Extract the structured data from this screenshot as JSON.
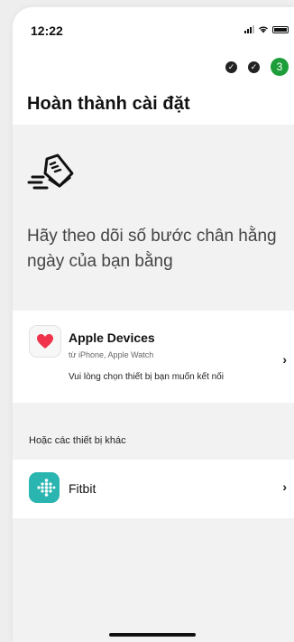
{
  "status_bar": {
    "time": "12:22"
  },
  "progress": {
    "done_steps": [
      "✓",
      "✓"
    ],
    "current_step": "3",
    "accent_color": "#1e9e3a"
  },
  "header": {
    "title": "Hoàn thành cài đặt"
  },
  "intro": {
    "icon": "shoe-speed-icon",
    "text": "Hãy theo dõi số bước chân hằng ngày của bạn bằng"
  },
  "apple_devices": {
    "icon": "heart-icon",
    "title": "Apple Devices",
    "subtitle": "từ iPhone, Apple Watch",
    "hint": "Vui lòng chọn thiết bị bạn muốn kết nối",
    "chevron": "›"
  },
  "other_devices": {
    "section_label": "Hoặc các thiết bị khác",
    "items": [
      {
        "icon": "fitbit-icon",
        "label": "Fitbit",
        "chevron": "›",
        "color": "#2bb5b0"
      }
    ]
  }
}
